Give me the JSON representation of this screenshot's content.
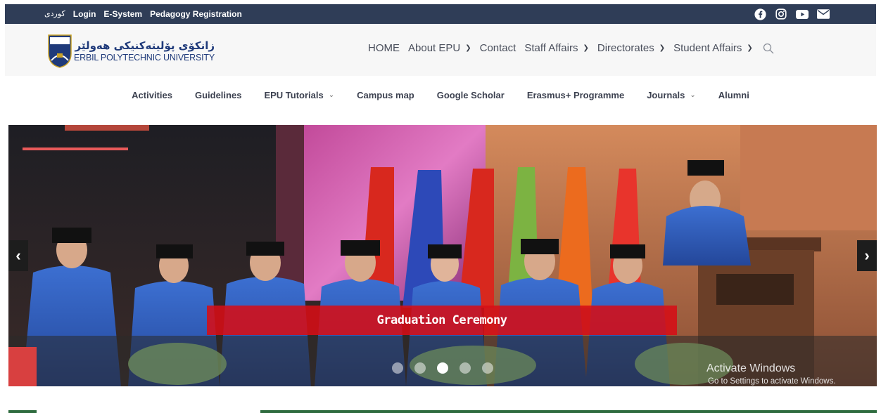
{
  "topbar": {
    "links": [
      "كوردی",
      "Login",
      "E-System",
      "Pedagogy Registration"
    ],
    "social_icons": [
      "facebook-icon",
      "instagram-icon",
      "youtube-icon",
      "email-icon"
    ]
  },
  "logo": {
    "kurdish": "زانكۆی پۆلیتەكنیكی هەولێر",
    "english": "ERBIL POLYTECHNIC UNIVERSITY",
    "badge_text": "EPU"
  },
  "mainnav": {
    "items": [
      {
        "label": "HOME",
        "has_dropdown": false
      },
      {
        "label": "About EPU",
        "has_dropdown": true
      },
      {
        "label": "Contact",
        "has_dropdown": false
      },
      {
        "label": "Staff Affairs",
        "has_dropdown": true
      },
      {
        "label": "Directorates",
        "has_dropdown": true
      },
      {
        "label": "Student Affairs",
        "has_dropdown": true
      }
    ]
  },
  "subnav": {
    "items": [
      {
        "label": "Activities",
        "has_dropdown": false
      },
      {
        "label": "Guidelines",
        "has_dropdown": false
      },
      {
        "label": "EPU Tutorials",
        "has_dropdown": true
      },
      {
        "label": "Campus map",
        "has_dropdown": false
      },
      {
        "label": "Google Scholar",
        "has_dropdown": false
      },
      {
        "label": "Erasmus+ Programme",
        "has_dropdown": false
      },
      {
        "label": "Journals",
        "has_dropdown": true
      },
      {
        "label": "Alumni",
        "has_dropdown": false
      }
    ]
  },
  "slider": {
    "caption": "Graduation Ceremony",
    "prev_glyph": "‹",
    "next_glyph": "›",
    "dot_count": 5,
    "active_dot": 2
  },
  "watermark": {
    "line1": "Activate Windows",
    "line2": "Go to Settings to activate Windows."
  },
  "colors": {
    "topbar_bg": "#2f3d57",
    "caption_bg": "#d60e16",
    "logo_blue": "#1f3a7a"
  }
}
